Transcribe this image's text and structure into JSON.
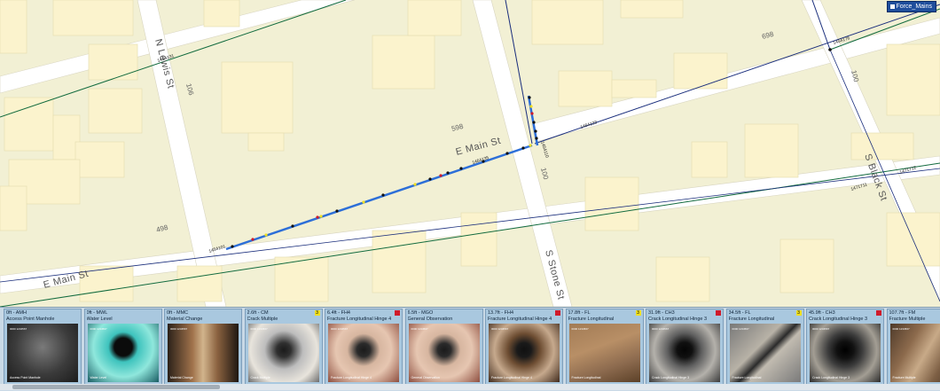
{
  "layer": {
    "name": "Force_Mains",
    "icon": "square-icon"
  },
  "streets": {
    "e_main_upper": "E Main St",
    "e_main_lower": "E Main St",
    "n_lewis": "N Lewis St",
    "s_stone": "S Stone St",
    "s_black": "S Black St"
  },
  "addresses": [
    "106",
    "598",
    "498",
    "698",
    "100",
    "100"
  ],
  "segment_ids": [
    "1454101",
    "1464133",
    "1464131",
    "1464135",
    "1454176",
    "1471711",
    "1471712",
    "1454110"
  ],
  "thumbnails": [
    {
      "title": "0ft - AMH",
      "desc": "Access Point Manhole",
      "badge": "",
      "badge_color": "",
      "overlay": "0000 1234567",
      "label": "Access Point Manhole",
      "img": "manhole"
    },
    {
      "title": "0ft - MWL",
      "desc": "Water Level",
      "badge": "",
      "badge_color": "",
      "overlay": "0000 1234567",
      "label": "Water Level",
      "img": "water"
    },
    {
      "title": "0ft - MMC",
      "desc": "Material Change",
      "badge": "",
      "badge_color": "",
      "overlay": "0000 1234567",
      "label": "Material Change",
      "img": "material"
    },
    {
      "title": "2.6ft - CM",
      "desc": "Crack Multiple",
      "badge": "3",
      "badge_color": "#f0e020",
      "overlay": "0000 1234567",
      "label": "Crack Multiple",
      "img": "pipe-light"
    },
    {
      "title": "6.4ft - FH4",
      "desc": "Fracture Longitudinal Hinge 4",
      "badge": "",
      "badge_color": "#d01a2a",
      "overlay": "0000 1234567",
      "label": "Fracture Longitudinal Hinge 4",
      "img": "pipe-pink"
    },
    {
      "title": "6.5ft - MGO",
      "desc": "General Observation",
      "badge": "",
      "badge_color": "",
      "overlay": "0000 1234567",
      "label": "General Observation",
      "img": "pipe-pink"
    },
    {
      "title": "13.7ft - FH4",
      "desc": "Fracture Longitudinal Hinge 4",
      "badge": "",
      "badge_color": "#d01a2a",
      "overlay": "0000 1234567",
      "label": "Fracture Longitudinal Hinge 4",
      "img": "pipe-brown"
    },
    {
      "title": "17.8ft - FL",
      "desc": "Fracture Longitudinal",
      "badge": "3",
      "badge_color": "#f0e020",
      "overlay": "0000 1234567",
      "label": "Fracture Longitudinal",
      "img": "wall"
    },
    {
      "title": "31.9ft - CH3",
      "desc": "Crack Longitudinal Hinge 3",
      "badge": "",
      "badge_color": "#d01a2a",
      "overlay": "0000 1234567",
      "label": "Crack Longitudinal Hinge 3",
      "img": "pipe-grey"
    },
    {
      "title": "34.5ft - FL",
      "desc": "Fracture Longitudinal",
      "badge": "3",
      "badge_color": "#f0e020",
      "overlay": "0000 1234567",
      "label": "Fracture Longitudinal",
      "img": "crack"
    },
    {
      "title": "45.9ft - CH3",
      "desc": "Crack Longitudinal Hinge 3",
      "badge": "",
      "badge_color": "#d01a2a",
      "overlay": "0000 1234567",
      "label": "Crack Longitudinal Hinge 3",
      "img": "pipe-dark"
    },
    {
      "title": "107.7ft - FM",
      "desc": "Fracture Multiple",
      "badge": "",
      "badge_color": "#d01a2a",
      "overlay": "0000 1234567",
      "label": "Fracture Multiple",
      "img": "rough"
    }
  ]
}
